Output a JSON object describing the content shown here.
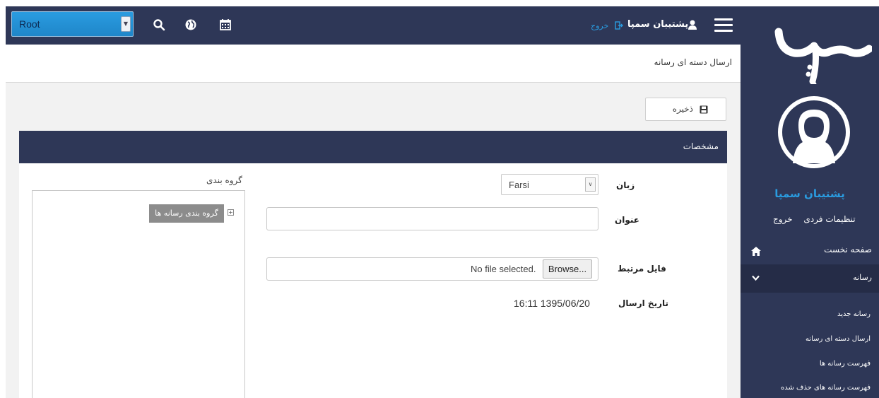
{
  "topbar": {
    "org_select_value": "Root",
    "user_name": "پشتیبان سمپا",
    "logout_label": "خروج"
  },
  "breadcrumb": {
    "title": "ارسال دسته ای رسانه"
  },
  "toolbar": {
    "save_label": "ذخیره"
  },
  "panel": {
    "title": "مشخصات",
    "fields": {
      "language_label": "زبان",
      "language_value": "Farsi",
      "title_label": "عنوان",
      "title_value": "",
      "file_label": "فایل مرتبط",
      "file_status": "No file selected.",
      "browse_label": "Browse...",
      "date_label": "تاریخ ارسال",
      "date_value": "16:11  1395/06/20"
    },
    "grouping": {
      "label": "گروه بندی",
      "root_node": "گروه بندی رسانه ها"
    }
  },
  "sidebar": {
    "logo_text": "سمپا",
    "profile_name": "پشتیبان سمپا",
    "personal_settings": "تنظیمات فردی",
    "logout": "خروج",
    "home": "صفحه نخست",
    "media_section": "رسانه",
    "media_items": [
      "رسانه جدید",
      "ارسال دسته ای رسانه",
      "فهرست رسانه ها",
      "فهرست رسانه های حذف شده"
    ]
  },
  "colors": {
    "nav_bg": "#2e3757",
    "accent_blue": "#2a9ce0",
    "content_bg": "#f2f2f2"
  },
  "icons": [
    "search-icon",
    "globe-icon",
    "calendar-icon",
    "user-icon",
    "logout-icon",
    "hamburger-icon",
    "save-icon",
    "home-icon",
    "chevron-down-icon",
    "avatar-icon"
  ]
}
